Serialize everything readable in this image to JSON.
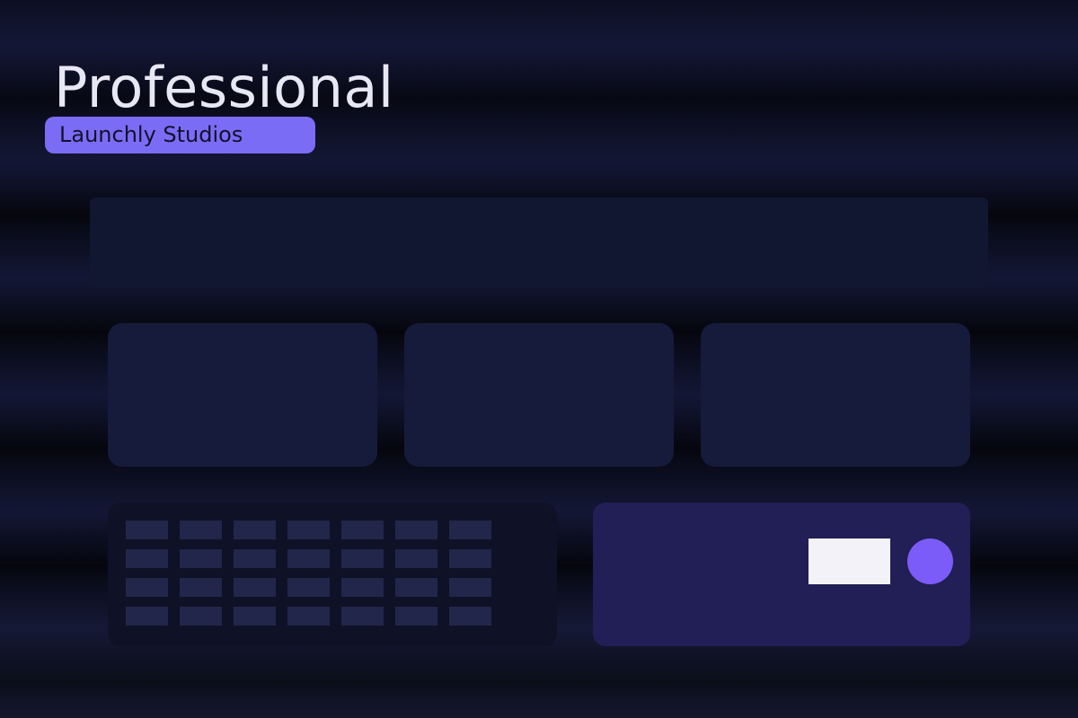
{
  "header": {
    "title": "Professional",
    "badge": "Launchly Studios"
  },
  "colors": {
    "background": "#0b0d1c",
    "accent": "#7b6cf6",
    "accent_strong": "#7c5cf8",
    "title_text": "#e8e8f4",
    "panel": "#161b3b",
    "action_panel": "#211f55"
  },
  "layout_counts": {
    "feature_cards": 3,
    "grid_rows": 4,
    "grid_cols": 7
  }
}
